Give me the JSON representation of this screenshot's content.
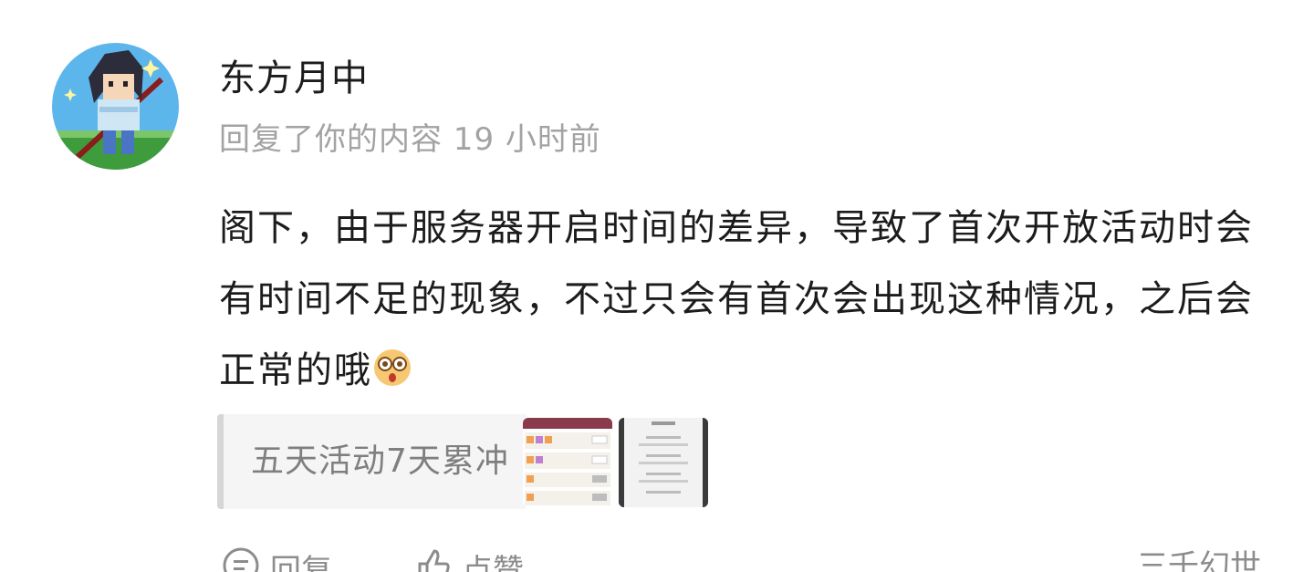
{
  "comment": {
    "username": "东方月中",
    "meta": "回复了你的内容 19 小时前",
    "body": "阁下，由于服务器开启时间的差异，导致了首次开放活动时会有时间不足的现象，不过只会有首次会出现这种情况，之后会正常的哦",
    "quote": "五天活动7天累冲"
  },
  "actions": {
    "reply_label": "回复",
    "like_label": "点赞",
    "album_label": "三千幻世"
  },
  "icons": {
    "avatar": "pixel-character-avatar",
    "emoji": "shocked-face-emoji",
    "reply": "comment-bubble-icon",
    "like": "thumbs-up-icon"
  },
  "colors": {
    "meta": "#a3a3a3",
    "quote_bg": "#f5f5f5",
    "quote_bar": "#d6d6d6"
  }
}
